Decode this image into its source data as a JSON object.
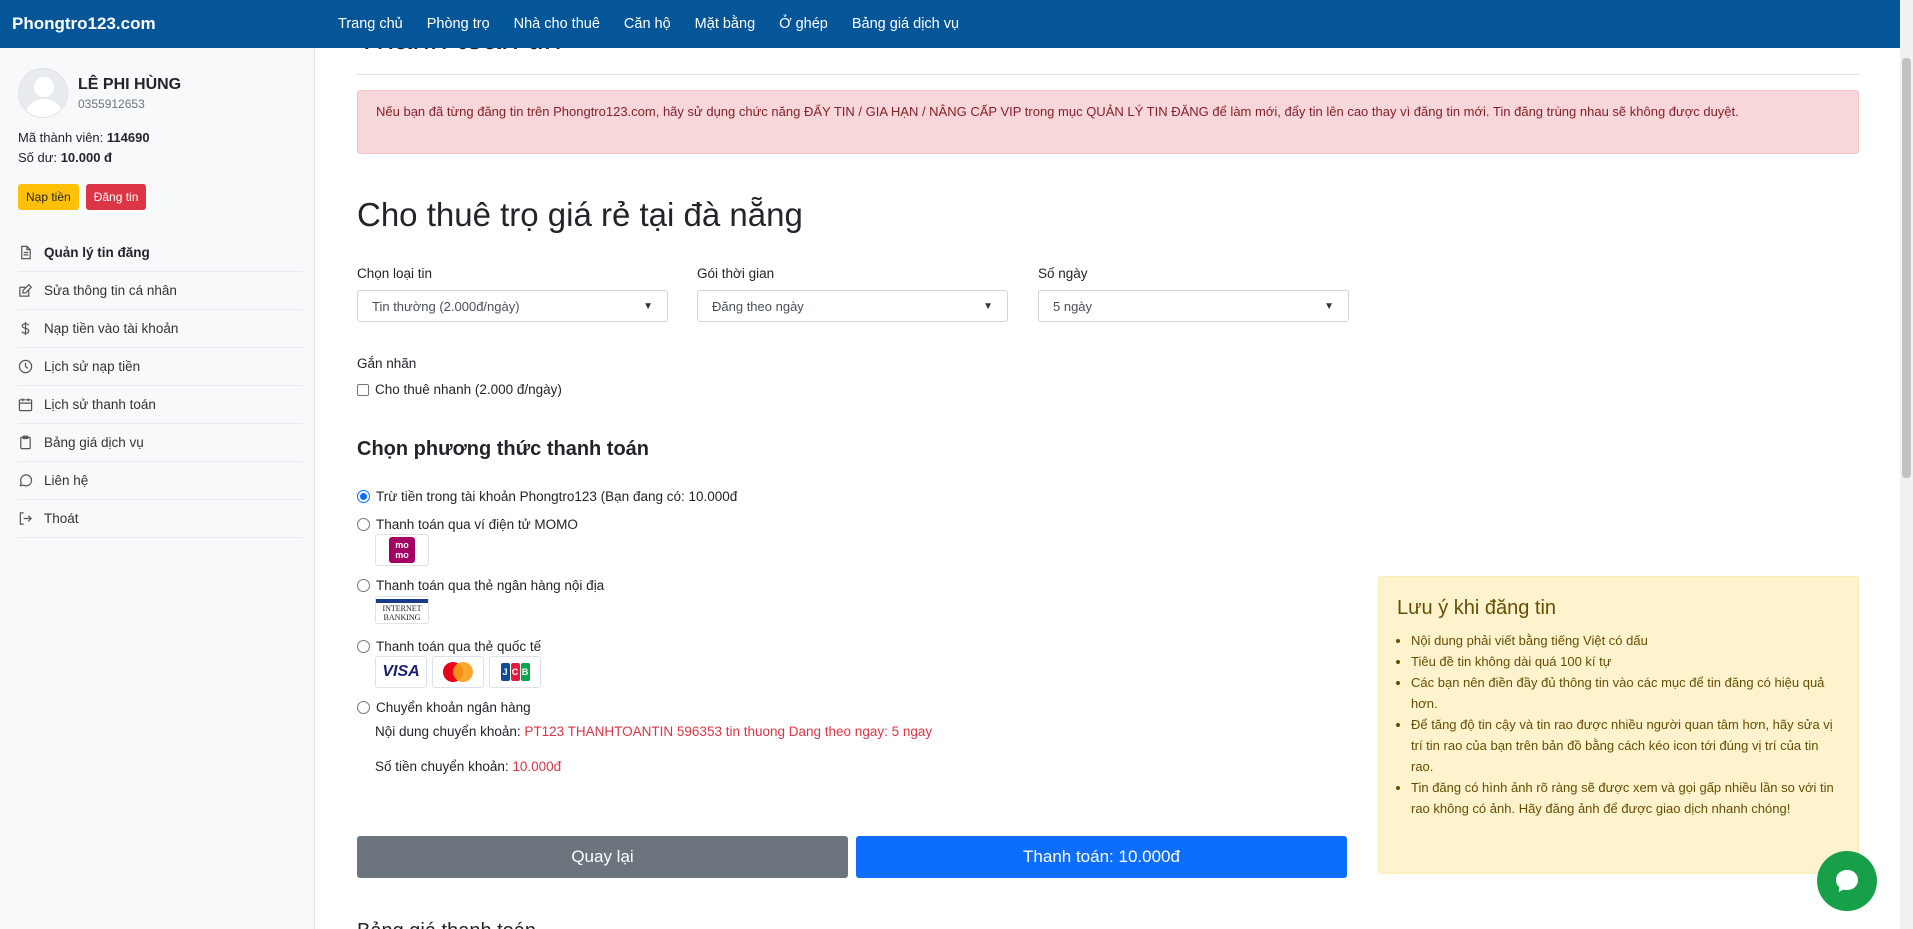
{
  "navbar": {
    "brand": "Phongtro123.com",
    "links": [
      "Trang chủ",
      "Phòng trọ",
      "Nhà cho thuê",
      "Căn hộ",
      "Mặt bằng",
      "Ở ghép",
      "Bảng giá dịch vụ"
    ],
    "color": "#055699"
  },
  "sidebar": {
    "user_name": "LÊ PHI HÙNG",
    "phone": "0355912653",
    "member_label": "Mã thành viên:",
    "member_id": "114690",
    "balance_label": "Số dư:",
    "balance": "10.000 đ",
    "topup_button": "Nạp tiền",
    "post_button": "Đăng tin",
    "menu": [
      {
        "label": "Quản lý tin đăng",
        "icon": "document-icon"
      },
      {
        "label": "Sửa thông tin cá nhân",
        "icon": "edit-icon"
      },
      {
        "label": "Nạp tiền vào tài khoản",
        "icon": "dollar-icon"
      },
      {
        "label": "Lịch sử nạp tiền",
        "icon": "clock-icon"
      },
      {
        "label": "Lịch sử thanh toán",
        "icon": "calendar-icon"
      },
      {
        "label": "Bảng giá dịch vụ",
        "icon": "clipboard-icon"
      },
      {
        "label": "Liên hệ",
        "icon": "chat-icon"
      },
      {
        "label": "Thoát",
        "icon": "logout-icon"
      }
    ]
  },
  "main": {
    "page_heading": "Thanh toán tin",
    "alert": "Nếu bạn đã từng đăng tin trên Phongtro123.com, hãy sử dụng chức năng ĐẨY TIN / GIA HẠN / NÂNG CẤP VIP trong mục QUẢN LÝ TIN ĐĂNG để làm mới, đẩy tin lên cao thay vì đăng tin mới. Tin đăng trùng nhau sẽ không được duyệt.",
    "post_title": "Cho thuê trọ giá rẻ tại đà nẵng",
    "fields": {
      "type_label": "Chọn loại tin",
      "type_value": "Tin thường (2.000đ/ngày)",
      "package_label": "Gói thời gian",
      "package_value": "Đăng theo ngày",
      "days_label": "Số ngày",
      "days_value": "5 ngày"
    },
    "tag_label": "Gắn nhãn",
    "tag_option": "Cho thuê nhanh (2.000 đ/ngày)",
    "payment_title": "Chọn phương thức thanh toán",
    "payment_options": [
      "Trừ tiền trong tài khoản Phongtro123 (Bạn đang có: 10.000đ",
      "Thanh toán qua ví điện tử MOMO",
      "Thanh toán qua thẻ ngân hàng nội địa",
      "Thanh toán qua thẻ quốc tế",
      "Chuyển khoản ngân hàng"
    ],
    "momo_logo": "mo mo",
    "internet_banking_logo": "INTERNET BANKING",
    "card_logos": [
      "VISA",
      "Mastercard",
      "JCB"
    ],
    "transfer_content_label": "Nội dung chuyển khoản:",
    "transfer_content": "PT123 THANHTOANTIN 596353 tin thuong Dang theo ngay: 5 ngay",
    "transfer_amount_label": "Số tiền chuyển khoản:",
    "transfer_amount": "10.000đ",
    "back_button": "Quay lại",
    "pay_button": "Thanh toán: 10.000đ",
    "bottom_heading": "Bảng giá thanh toán"
  },
  "note": {
    "title": "Lưu ý khi đăng tin",
    "items": [
      "Nội dung phải viết bằng tiếng Việt có dấu",
      "Tiêu đề tin không dài quá 100 kí tự",
      "Các bạn nên điền đầy đủ thông tin vào các mục để tin đăng có hiệu quả hơn.",
      "Để tăng độ tin cậy và tin rao được nhiều người quan tâm hơn, hãy sửa vị trí tin rao của bạn trên bản đồ bằng cách kéo icon tới đúng vị trí của tin rao.",
      "Tin đăng có hình ảnh rõ ràng sẽ được xem và gọi gấp nhiều lần so với tin rao không có ảnh. Hãy đăng ảnh để được giao dịch nhanh chóng!"
    ]
  }
}
